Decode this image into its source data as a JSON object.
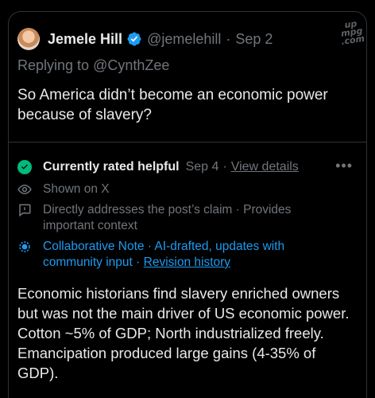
{
  "watermark": {
    "line1": "up",
    "line2": "mpg",
    "line3": ".com"
  },
  "tweet": {
    "author_name": "Jemele Hill",
    "handle": "@jemelehill",
    "separator": "·",
    "date": "Sep 2",
    "replying_prefix": "Replying to ",
    "replying_to": "@CynthZee",
    "text": "So America didn’t become an economic power because of slavery?"
  },
  "note": {
    "status": "Currently rated helpful",
    "date": "Sep 4",
    "separator": "·",
    "view_details": "View details",
    "more": "•••",
    "shown_on": "Shown on X",
    "reasons": "Directly addresses the post’s claim · Provides important context",
    "collab_text": "Collaborative Note · AI-drafted, updates with community input · ",
    "revision_history": "Revision history",
    "body": "Economic historians find slavery enriched owners but was not the main driver of US economic power. Cotton ~5% of GDP; North industrialized freely. Emancipation produced large gains (4-35% of GDP)."
  },
  "colors": {
    "background": "#000000",
    "text": "#e7e9ea",
    "muted": "#71767b",
    "accent": "#1d9bf0",
    "helpful_green": "#00ba7c"
  },
  "icons": [
    "verified-badge-icon",
    "check-circle-icon",
    "eye-icon",
    "speech-bubble-alert-icon",
    "collaborative-note-icon",
    "more-options-icon"
  ]
}
